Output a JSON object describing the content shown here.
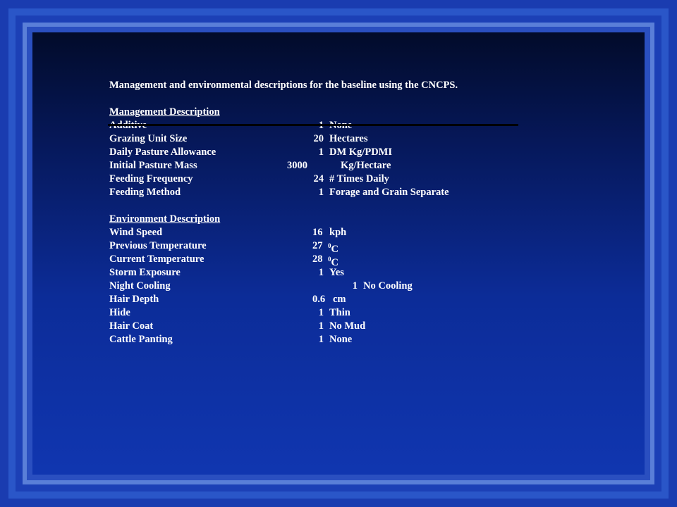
{
  "title": "Management and environmental descriptions for the baseline using the CNCPS.",
  "management": {
    "heading": "Management Description",
    "rows": [
      {
        "label": "Additive",
        "num": "1",
        "unit": "None"
      },
      {
        "label": "Grazing Unit Size",
        "num": "20",
        "unit": "Hectares"
      },
      {
        "label": "Daily Pasture Allowance",
        "num": "1",
        "unit": "DM Kg/PDMI"
      },
      {
        "label": "Initial Pasture Mass",
        "num": "3000",
        "unit": "Kg/Hectare"
      },
      {
        "label": "Feeding Frequency",
        "num": "24",
        "unit": "# Times Daily"
      },
      {
        "label": "Feeding Method",
        "num": "1",
        "unit": "Forage and Grain Separate"
      }
    ]
  },
  "environment": {
    "heading": "Environment Description",
    "rows": [
      {
        "label": "Wind Speed",
        "num": "16",
        "unit": "kph"
      },
      {
        "label": "Previous Temperature",
        "num": "27",
        "sup": "0",
        "unit": "C"
      },
      {
        "label": "Current Temperature",
        "num": "28",
        "sup": "0",
        "unit": "C"
      },
      {
        "label": "Storm Exposure",
        "num": "1",
        "unit": "Yes"
      },
      {
        "label": "Night Cooling",
        "num": "1",
        "unit": "No Cooling"
      },
      {
        "label": "Hair Depth",
        "num": "0.6",
        "unit": "cm"
      },
      {
        "label": "Hide",
        "num": "1",
        "unit": "Thin"
      },
      {
        "label": "Hair Coat",
        "num": "1",
        "unit": "No Mud"
      },
      {
        "label": "Cattle Panting",
        "num": "1",
        "unit": "None"
      }
    ]
  }
}
